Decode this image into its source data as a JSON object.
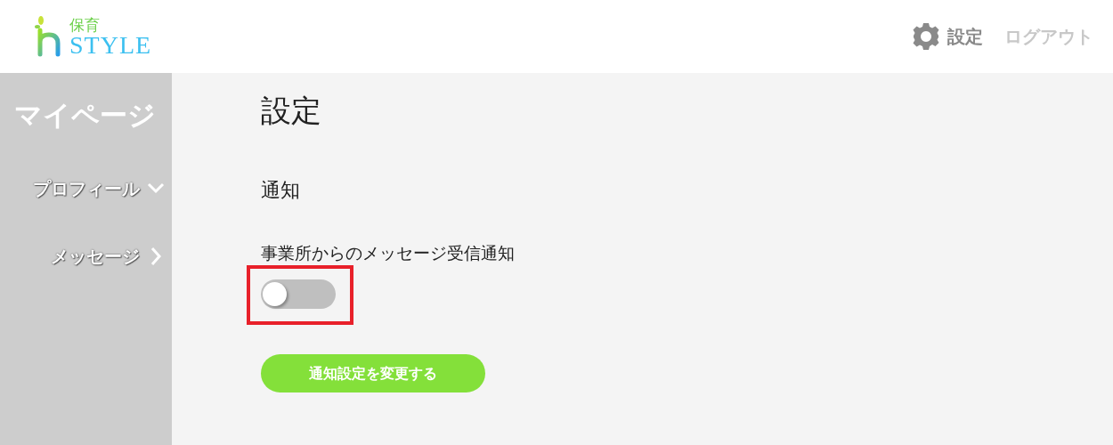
{
  "header": {
    "logo": {
      "top": "保育",
      "bottom": "STYLE"
    },
    "nav": [
      {
        "kind": "settings",
        "label": "設定"
      },
      {
        "kind": "logout",
        "label": "ログアウト"
      }
    ]
  },
  "sidebar": {
    "title": "マイページ",
    "items": [
      {
        "label": "プロフィール",
        "expanded": true
      },
      {
        "label": "メッセージ",
        "expanded": false
      }
    ]
  },
  "main": {
    "title": "設定",
    "section": "通知",
    "setting": {
      "label": "事業所からのメッセージ受信通知",
      "on": false,
      "highlighted": true
    },
    "submit": "通知設定を変更する"
  }
}
